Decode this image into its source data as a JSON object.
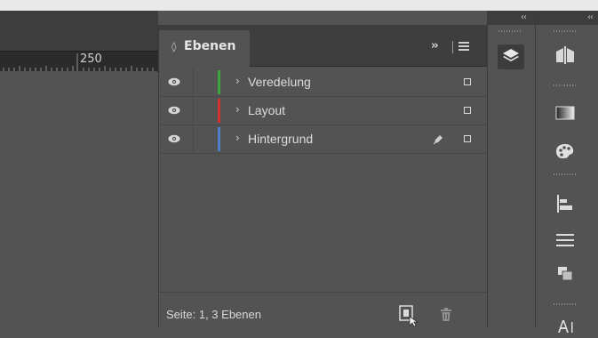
{
  "ruler": {
    "label": "250"
  },
  "panel": {
    "tab_title": "Ebenen",
    "tab_arrows_icon": "updown-arrows-icon",
    "collapse_icon": "double-chevron-right-icon",
    "menu_icon": "panel-menu-icon",
    "layers": [
      {
        "name": "Veredelung",
        "color": "#3fa63f",
        "visible": true,
        "selected_indicator": true
      },
      {
        "name": "Layout",
        "color": "#d6322c",
        "visible": true,
        "selected_indicator": true
      },
      {
        "name": "Hintergrund",
        "color": "#4f7fc8",
        "visible": true,
        "has_pen": true,
        "selected_indicator": true
      }
    ],
    "status": "Seite: 1, 3 Ebenen",
    "new_layer_icon": "new-layer-icon",
    "trash_icon": "trash-icon"
  },
  "dock1": {
    "collapse_label": "‹‹",
    "items": [
      {
        "icon": "layers-icon",
        "active": true
      }
    ]
  },
  "dock2": {
    "collapse_label": "‹‹",
    "items": [
      {
        "icon": "pages-icon"
      },
      {
        "icon": "gradient-icon"
      },
      {
        "icon": "swatches-palette-icon"
      },
      {
        "icon": "align-icon"
      },
      {
        "icon": "stroke-icon"
      },
      {
        "icon": "pathfinder-icon"
      },
      {
        "icon": "character-icon"
      }
    ]
  }
}
